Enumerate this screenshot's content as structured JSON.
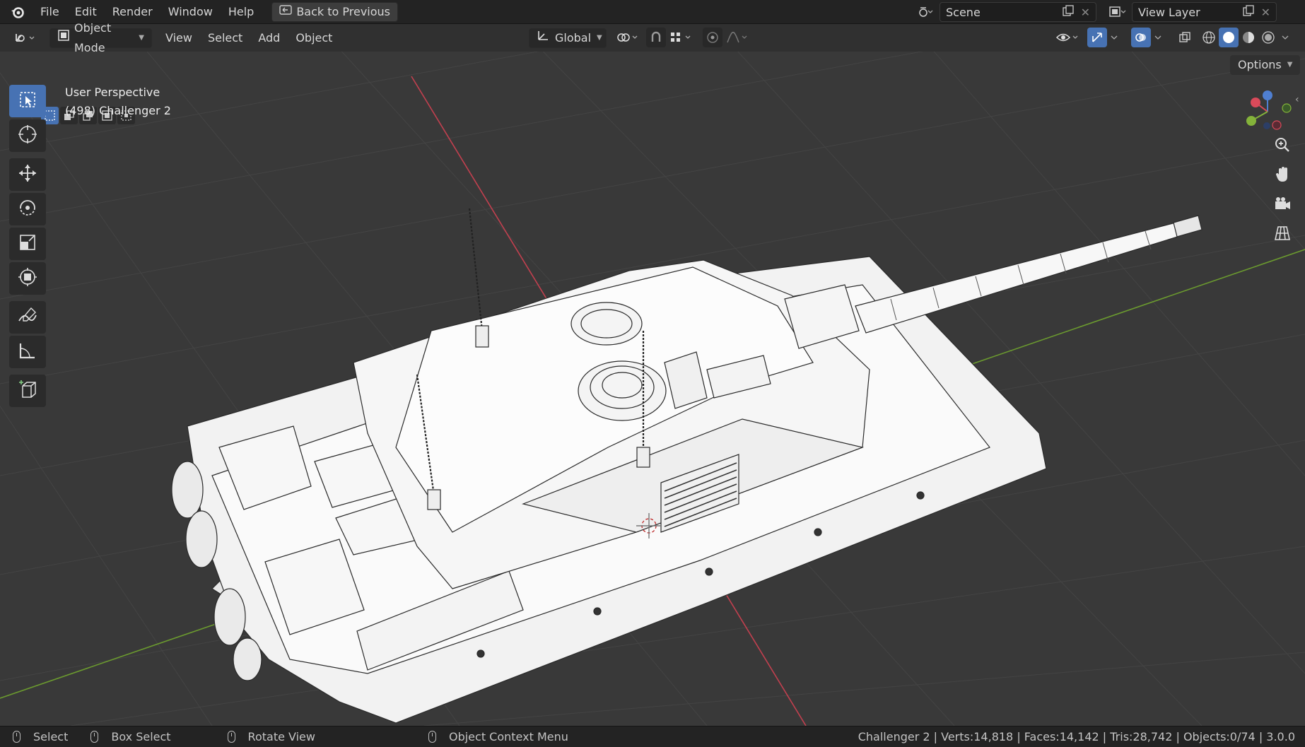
{
  "topbar": {
    "menus": [
      "File",
      "Edit",
      "Render",
      "Window",
      "Help"
    ],
    "back_button": "Back to Previous",
    "scene": "Scene",
    "view_layer": "View Layer"
  },
  "header": {
    "mode": "Object Mode",
    "menus": [
      "View",
      "Select",
      "Add",
      "Object"
    ],
    "orientation": "Global",
    "options": "Options"
  },
  "viewport": {
    "perspective": "User Perspective",
    "object_label": "(498) Challenger 2",
    "background_color": "#393939",
    "x_axis_color": "#c2404f",
    "y_axis_color": "#6b9a2f"
  },
  "toolbar": {
    "tools": [
      "select-box-icon",
      "cursor-icon",
      "move-icon",
      "rotate-icon",
      "scale-icon",
      "transform-icon",
      "annotate-icon",
      "measure-icon",
      "add-cube-icon"
    ]
  },
  "statusbar": {
    "select": "Select",
    "box_select": "Box Select",
    "rotate_view": "Rotate View",
    "context_menu": "Object Context Menu",
    "stats": "Challenger 2 | Verts:14,818 | Faces:14,142 | Tris:28,742 | Objects:0/74 | 3.0.0"
  },
  "accent_color": "#4772b3"
}
